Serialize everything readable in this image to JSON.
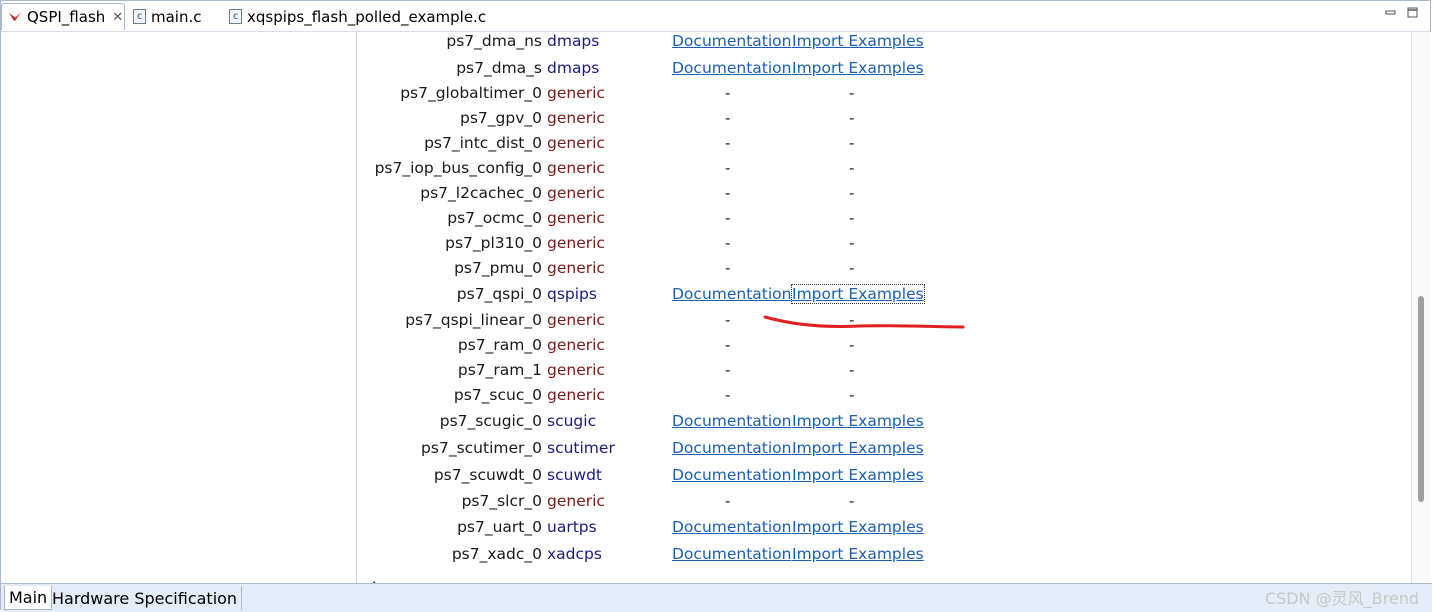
{
  "tabs": [
    {
      "label": "QSPI_flash",
      "icon": "xilinx-logo-icon",
      "active": true,
      "closable": true
    },
    {
      "label": "main.c",
      "icon": "c-file-icon",
      "active": false
    },
    {
      "label": "xqspips_flash_polled_example.c",
      "icon": "c-file-icon",
      "active": false
    }
  ],
  "peripherals": [
    {
      "name": "ps7_dma_ns",
      "driver": "dmaps",
      "generic": false,
      "doc": "Documentation",
      "imp": "Import Examples"
    },
    {
      "name": "ps7_dma_s",
      "driver": "dmaps",
      "generic": false,
      "doc": "Documentation",
      "imp": "Import Examples"
    },
    {
      "name": "ps7_globaltimer_0",
      "driver": "generic",
      "generic": true,
      "doc": "-",
      "imp": "-"
    },
    {
      "name": "ps7_gpv_0",
      "driver": "generic",
      "generic": true,
      "doc": "-",
      "imp": "-"
    },
    {
      "name": "ps7_intc_dist_0",
      "driver": "generic",
      "generic": true,
      "doc": "-",
      "imp": "-"
    },
    {
      "name": "ps7_iop_bus_config_0",
      "driver": "generic",
      "generic": true,
      "doc": "-",
      "imp": "-"
    },
    {
      "name": "ps7_l2cachec_0",
      "driver": "generic",
      "generic": true,
      "doc": "-",
      "imp": "-"
    },
    {
      "name": "ps7_ocmc_0",
      "driver": "generic",
      "generic": true,
      "doc": "-",
      "imp": "-"
    },
    {
      "name": "ps7_pl310_0",
      "driver": "generic",
      "generic": true,
      "doc": "-",
      "imp": "-"
    },
    {
      "name": "ps7_pmu_0",
      "driver": "generic",
      "generic": true,
      "doc": "-",
      "imp": "-"
    },
    {
      "name": "ps7_qspi_0",
      "driver": "qspips",
      "generic": false,
      "doc": "Documentation",
      "imp": "Import Examples",
      "focused": true
    },
    {
      "name": "ps7_qspi_linear_0",
      "driver": "generic",
      "generic": true,
      "doc": "-",
      "imp": "-"
    },
    {
      "name": "ps7_ram_0",
      "driver": "generic",
      "generic": true,
      "doc": "-",
      "imp": "-"
    },
    {
      "name": "ps7_ram_1",
      "driver": "generic",
      "generic": true,
      "doc": "-",
      "imp": "-"
    },
    {
      "name": "ps7_scuc_0",
      "driver": "generic",
      "generic": true,
      "doc": "-",
      "imp": "-"
    },
    {
      "name": "ps7_scugic_0",
      "driver": "scugic",
      "generic": false,
      "doc": "Documentation",
      "imp": "Import Examples"
    },
    {
      "name": "ps7_scutimer_0",
      "driver": "scutimer",
      "generic": false,
      "doc": "Documentation",
      "imp": "Import Examples"
    },
    {
      "name": "ps7_scuwdt_0",
      "driver": "scuwdt",
      "generic": false,
      "doc": "Documentation",
      "imp": "Import Examples"
    },
    {
      "name": "ps7_slcr_0",
      "driver": "generic",
      "generic": true,
      "doc": "-",
      "imp": "-"
    },
    {
      "name": "ps7_uart_0",
      "driver": "uartps",
      "generic": false,
      "doc": "Documentation",
      "imp": "Import Examples"
    },
    {
      "name": "ps7_xadc_0",
      "driver": "xadcps",
      "generic": false,
      "doc": "Documentation",
      "imp": "Import Examples"
    }
  ],
  "bottom_tabs": [
    {
      "label": "Main",
      "active": true
    },
    {
      "label": "Hardware Specification",
      "active": false
    }
  ],
  "watermark": "CSDN @灵风_Brend",
  "colors": {
    "link": "#1a5fb4",
    "generic_driver": "#7a1a1a",
    "driver": "#1a1a80",
    "annotation_stroke": "#e02020"
  }
}
